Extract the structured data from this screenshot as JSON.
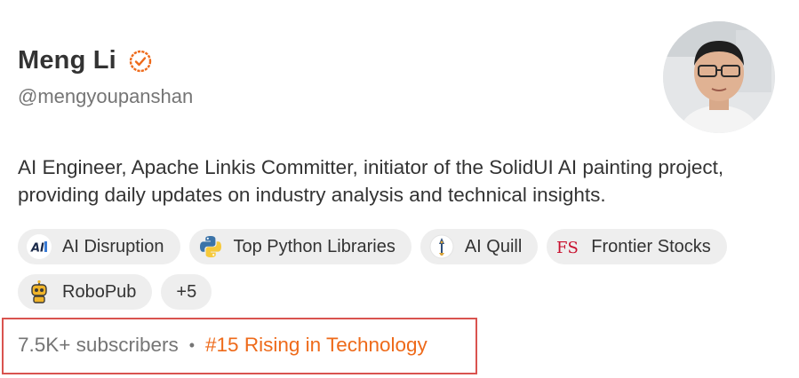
{
  "profile": {
    "name": "Meng Li",
    "handle": "@mengyoupanshan",
    "bio": "AI Engineer, Apache Linkis Committer, initiator of the SolidUI AI painting project, providing daily updates on industry analysis and technical insights.",
    "accent_color": "#ee6a1a"
  },
  "publications": [
    {
      "label": "AI Disruption",
      "icon": "ai-disruption-logo"
    },
    {
      "label": "Top Python Libraries",
      "icon": "python-logo"
    },
    {
      "label": "AI Quill",
      "icon": "quill-logo"
    },
    {
      "label": "Frontier Stocks",
      "icon": "fs-logo"
    },
    {
      "label": "RoboPub",
      "icon": "robot-logo"
    }
  ],
  "more_label": "+5",
  "stats": {
    "subscribers": "7.5K+ subscribers",
    "separator": "•",
    "rank": "#15 Rising in Technology"
  }
}
